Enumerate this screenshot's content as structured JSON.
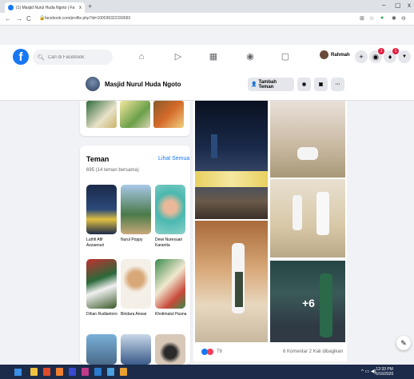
{
  "browser": {
    "tab_title": "(1) Masjid Nurul Huda Ngoto | Fa",
    "tab_close": "x",
    "new_tab": "+",
    "url": "facebook.com/profile.php?id=100036322159693",
    "window_controls": [
      "–",
      "▢",
      "x"
    ]
  },
  "header": {
    "search_placeholder": "Cari di Facebook",
    "user_name": "Rahmah",
    "badges": {
      "messenger": "1",
      "notifications": "1"
    }
  },
  "page": {
    "name": "Masjid Nurul Huda Ngoto",
    "add_friend_label": "Tambah Teman",
    "more_label": "···"
  },
  "friends": {
    "title": "Teman",
    "see_all": "Lihat Semua",
    "count_text": "695 (14 teman bersama)",
    "items": [
      {
        "name": "Luthfi Afif Azzaenuri"
      },
      {
        "name": "Nurul Poppy"
      },
      {
        "name": "Dewi Nuresuari Karanita"
      },
      {
        "name": "Dihan Rudiantoro"
      },
      {
        "name": "Bindara Anwar"
      },
      {
        "name": "Khotimatul Husna"
      }
    ]
  },
  "post": {
    "more_photos": "+6",
    "reaction_count": "79",
    "stats": "6 Komentar  2 Kali dibagikan"
  },
  "taskbar": {
    "time": "12:33 PM",
    "date": "6/16/2020"
  },
  "colors": {
    "brand": "#1877f2",
    "badge": "#e41e3f",
    "taskbar": "#1c2b4a"
  },
  "icons": [
    "facebook-logo-icon",
    "search-icon",
    "home-icon",
    "video-icon",
    "marketplace-icon",
    "groups-icon",
    "gaming-icon",
    "plus-icon",
    "messenger-icon",
    "bell-icon",
    "chevron-down-icon",
    "add-friend-icon",
    "message-icon",
    "chat-icon"
  ]
}
